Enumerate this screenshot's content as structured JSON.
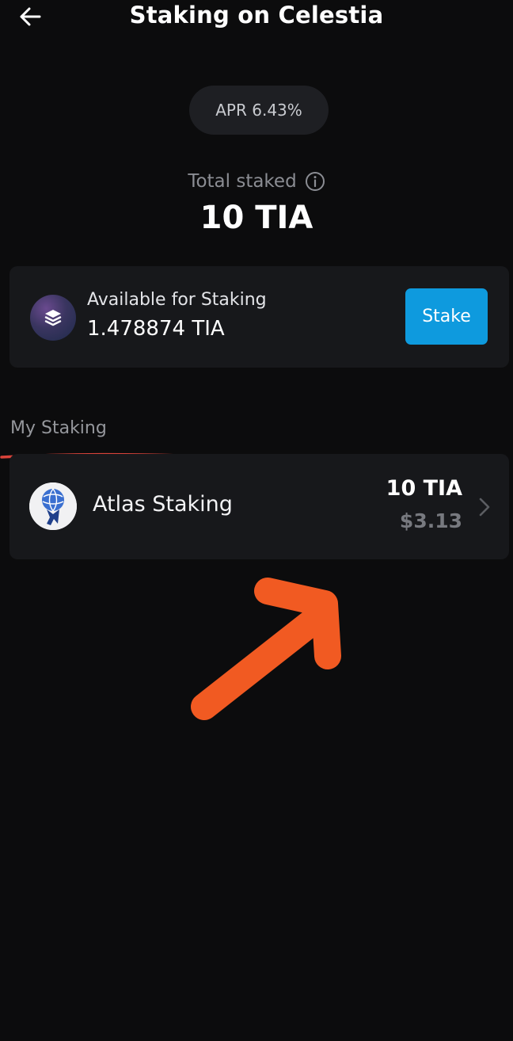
{
  "header": {
    "title": "Staking on Celestia",
    "back_icon": "arrow-left-icon"
  },
  "apr": {
    "label": "APR 6.43%"
  },
  "total": {
    "label": "Total staked",
    "info_icon": "info-circle-icon",
    "value": "10 TIA"
  },
  "available": {
    "icon": "stack-layers-icon",
    "label": "Available for Staking",
    "amount": "1.478874 TIA",
    "stake_button": "Stake"
  },
  "my_staking": {
    "title": "My Staking",
    "items": [
      {
        "name": "Atlas Staking",
        "amount": "10 TIA",
        "usd": "$3.13",
        "avatar_icon": "atlas-globe-logo",
        "chevron_icon": "chevron-right-icon"
      }
    ]
  },
  "colors": {
    "background": "#0c0c0d",
    "card": "#17181b",
    "accent": "#0e9ade",
    "annotation": "#f15a22"
  }
}
